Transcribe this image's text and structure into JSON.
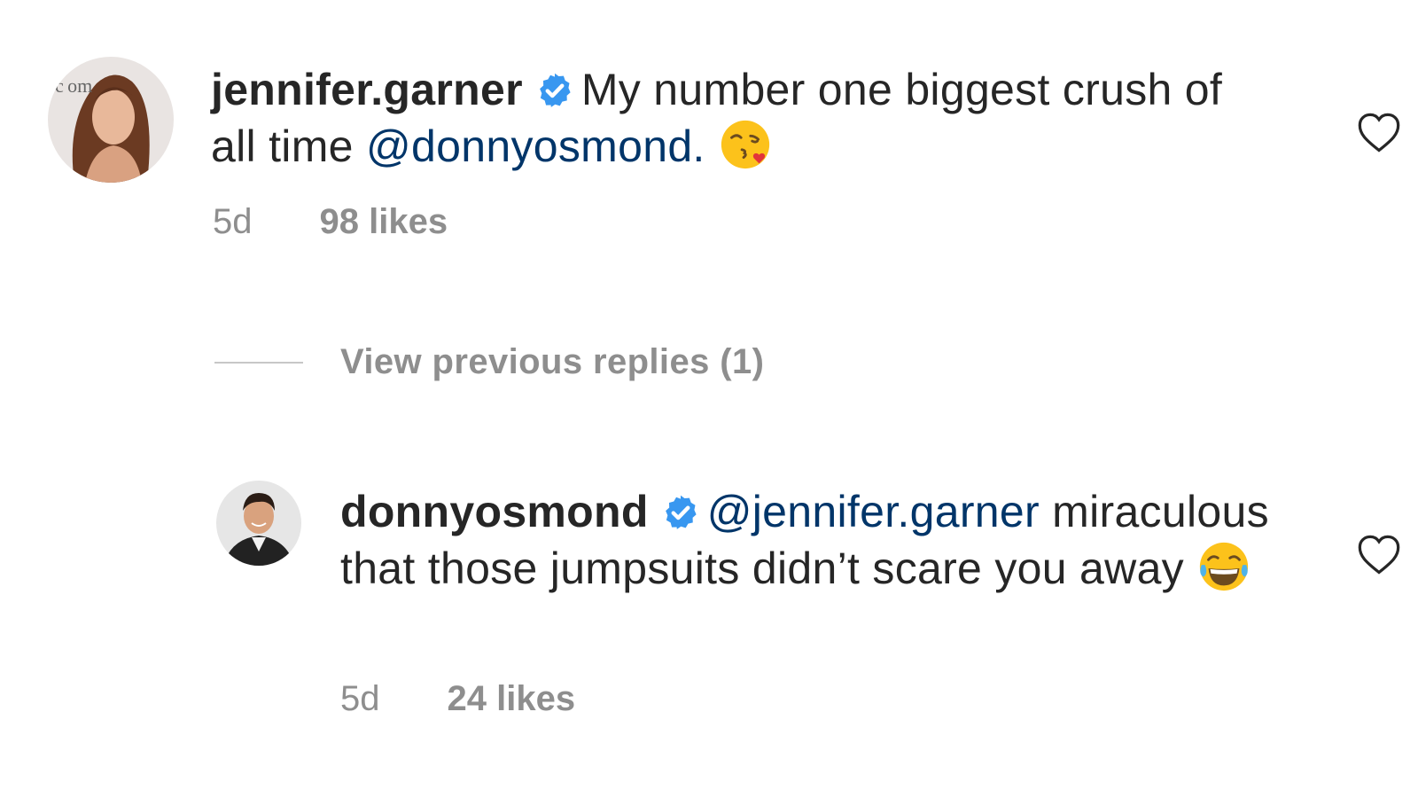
{
  "comments": [
    {
      "username": "jennifer.garner",
      "verified": true,
      "text": "My number one biggest crush of all time ",
      "mention": "@donnyosmond.",
      "text_after": "",
      "emoji": "face-blowing-kiss",
      "time": "5d",
      "likes": "98 likes",
      "avatar_watermark": "c om"
    },
    {
      "username": "donnyosmond",
      "verified": true,
      "mention": "@jennifer.garner",
      "text": " miraculous that those jumpsuits didn’t scare you away",
      "emoji": "face-with-tears-of-joy",
      "time": "5d",
      "likes": "24 likes"
    }
  ],
  "view_replies": "View previous replies (1)",
  "colors": {
    "text": "#262626",
    "muted": "#8e8e8e",
    "mention": "#003569",
    "verified": "#3897f0",
    "divider": "#c7c7c7"
  }
}
